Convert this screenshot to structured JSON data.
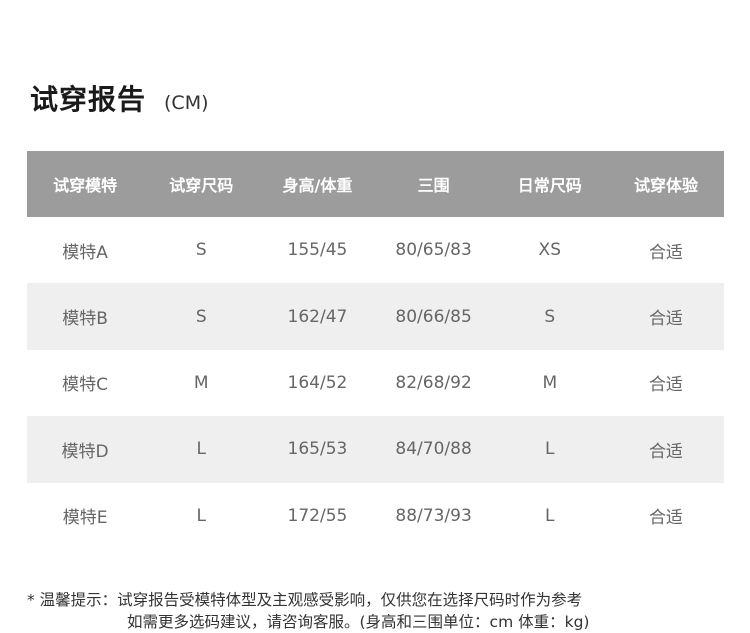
{
  "report": {
    "title": "试穿报告",
    "unit": "(CM)"
  },
  "table": {
    "headers": [
      "试穿模特",
      "试穿尺码",
      "身高/体重",
      "三围",
      "日常尺码",
      "试穿体验"
    ],
    "rows": [
      [
        "模特A",
        "S",
        "155/45",
        "80/65/83",
        "XS",
        "合适"
      ],
      [
        "模特B",
        "S",
        "162/47",
        "80/66/85",
        "S",
        "合适"
      ],
      [
        "模特C",
        "M",
        "164/52",
        "82/68/92",
        "M",
        "合适"
      ],
      [
        "模特D",
        "L",
        "165/53",
        "84/70/88",
        "L",
        "合适"
      ],
      [
        "模特E",
        "L",
        "172/55",
        "88/73/93",
        "L",
        "合适"
      ]
    ]
  },
  "note": {
    "line1": "* 温馨提示：试穿报告受模特体型及主观感受影响，仅供您在选择尺码时作为参考",
    "line2": "如需更多选码建议，请咨询客服。(身高和三围单位：cm 体重：kg)"
  }
}
